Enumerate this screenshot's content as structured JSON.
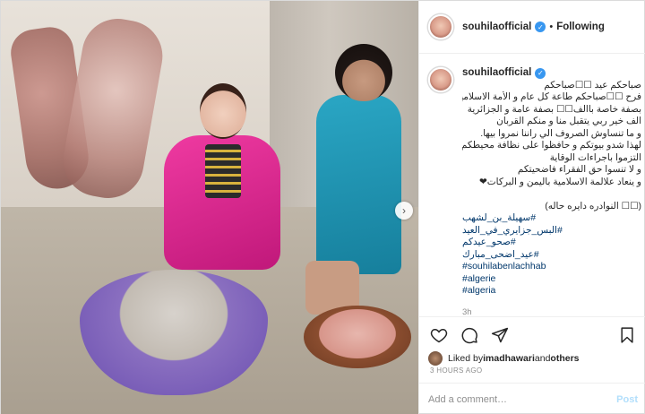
{
  "header": {
    "username": "souhilaofficial",
    "separator": "•",
    "follow_label": "Following"
  },
  "caption": {
    "username": "souhilaofficial",
    "lines": [
      "صباحكم عيد ☐☐صباحكم",
      "فرح ☐☐صباحكم طاعة كل عام و الأمة الاسلامية",
      "بصفة خاصة باالف☐☐ بصفة عامة و الجزائرية",
      "الف خير ربي يتقبل منا و منكم القربان",
      "و ما تنساوش الصروف الي راننا نمروا بيها.",
      "لهذا شدو بيوتكم و حافظوا على نظافة محيطكم و",
      "التزموا باجراءات الوقاية",
      "و لا تنسوا حق الفقراء فاضحيتكم",
      "و ينعاد علالمة الاسلامية باليمن و البركات❤",
      "",
      "(☐☐ النوادره دايره حاله)"
    ],
    "hashtags": [
      "#سهيلة_بن_لشهب",
      "#البس_جزايري_في_العيد",
      "#صحو_عيدكم",
      "#عيد_اضحى_مبارك",
      "#souhilabenlachhab",
      "#algerie",
      "#algeria"
    ],
    "time": "3h"
  },
  "likes": {
    "prefix": "Liked by ",
    "user": "imadhawari",
    "middle": " and ",
    "others": "others"
  },
  "posted_ago": "3 HOURS AGO",
  "comment_box": {
    "placeholder": "Add a comment…",
    "post_label": "Post"
  },
  "photo": {
    "next_glyph": "›"
  },
  "colors": {
    "link": "#00376b",
    "verified": "#3897f0",
    "muted": "#8e8e8e",
    "post_disabled": "#b2dffc"
  }
}
